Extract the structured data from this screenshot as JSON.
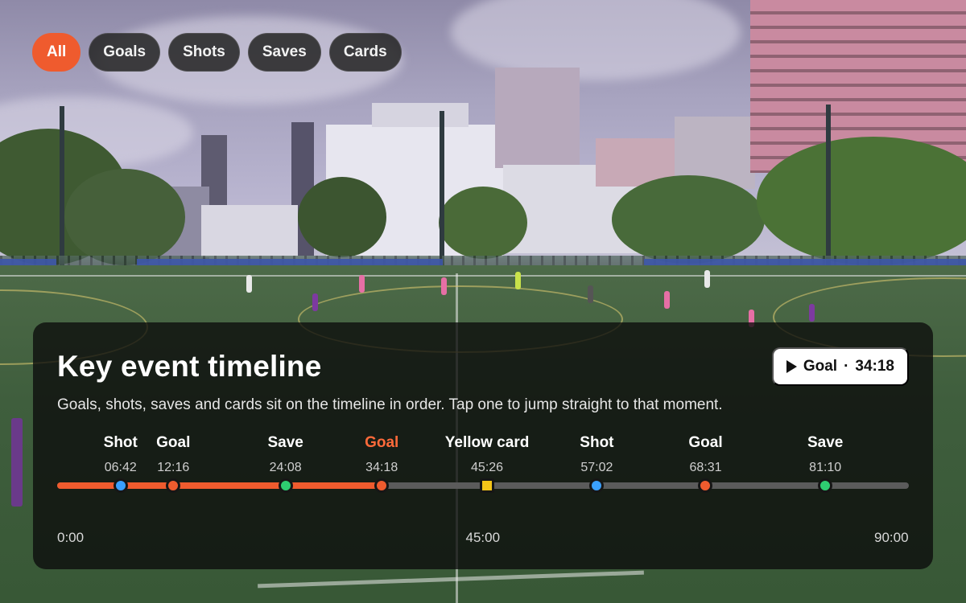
{
  "filters": {
    "items": [
      {
        "label": "All",
        "active": true
      },
      {
        "label": "Goals",
        "active": false
      },
      {
        "label": "Shots",
        "active": false
      },
      {
        "label": "Saves",
        "active": false
      },
      {
        "label": "Cards",
        "active": false
      }
    ]
  },
  "panel": {
    "title": "Key event timeline",
    "subtitle": "Goals, shots, saves and cards sit on the timeline in order. Tap one to jump straight to that moment.",
    "current": {
      "type": "Goal",
      "separator": "·",
      "time": "34:18"
    }
  },
  "timeline": {
    "duration_min": 90,
    "position_min": 34.3,
    "ticks": [
      {
        "label": "0:00",
        "min": 0
      },
      {
        "label": "45:00",
        "min": 45
      },
      {
        "label": "90:00",
        "min": 90
      }
    ],
    "events": [
      {
        "type": "Shot",
        "time": "06:42",
        "min": 6.7,
        "marker": "circle",
        "color": "#3aa0ff"
      },
      {
        "type": "Goal",
        "time": "12:16",
        "min": 12.27,
        "marker": "circle",
        "color": "#ef5b2e"
      },
      {
        "type": "Save",
        "time": "24:08",
        "min": 24.13,
        "marker": "circle",
        "color": "#2ecc71"
      },
      {
        "type": "Goal",
        "time": "34:18",
        "min": 34.3,
        "marker": "circle",
        "color": "#ef5b2e",
        "current": true
      },
      {
        "type": "Yellow card",
        "time": "45:26",
        "min": 45.43,
        "marker": "square",
        "color": "#f5c518"
      },
      {
        "type": "Shot",
        "time": "57:02",
        "min": 57.03,
        "marker": "circle",
        "color": "#3aa0ff"
      },
      {
        "type": "Goal",
        "time": "68:31",
        "min": 68.52,
        "marker": "circle",
        "color": "#ef5b2e"
      },
      {
        "type": "Save",
        "time": "81:10",
        "min": 81.17,
        "marker": "circle",
        "color": "#2ecc71"
      }
    ]
  },
  "colors": {
    "accent": "#ef5b2e",
    "track": "#5b5b5b"
  }
}
